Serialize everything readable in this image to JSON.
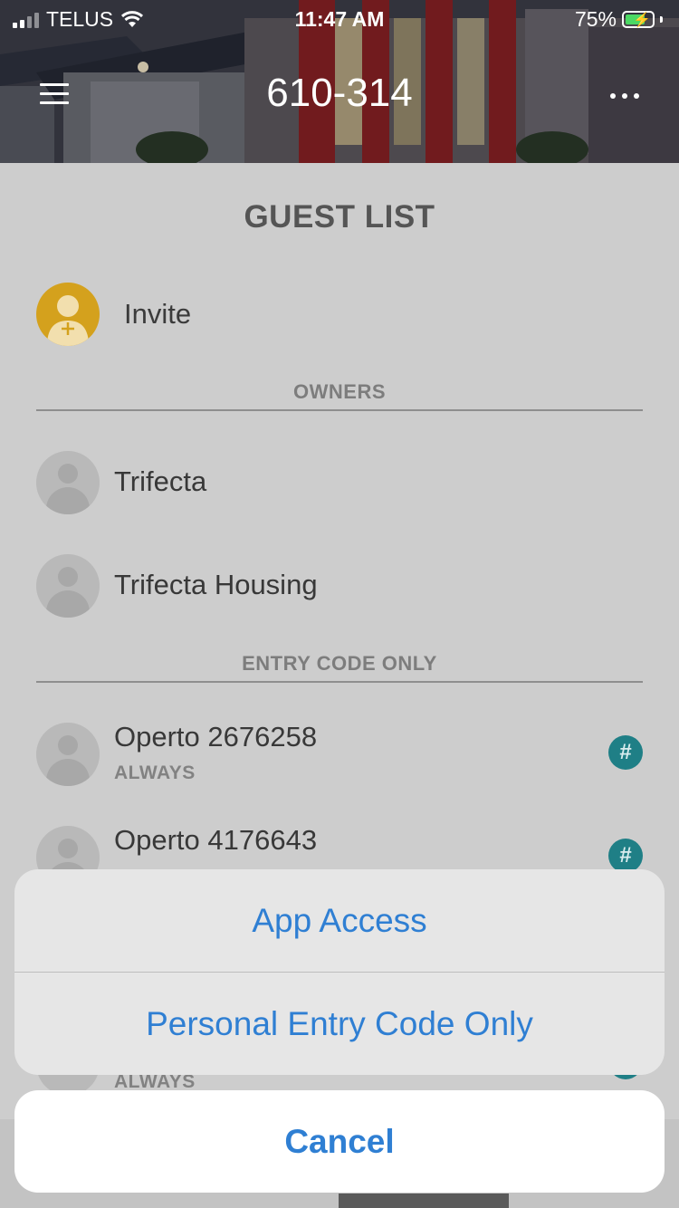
{
  "status_bar": {
    "carrier": "TELUS",
    "time": "11:47 AM",
    "battery": "75%",
    "battery_level": 0.75
  },
  "header": {
    "title": "610-314",
    "menu_icon": "hamburger-menu-icon",
    "more_icon": "more-dots-icon"
  },
  "page": {
    "title": "GUEST LIST",
    "invite_label": "Invite"
  },
  "sections": {
    "owners": "OWNERS",
    "entry_code_only": "ENTRY CODE ONLY"
  },
  "owners": [
    {
      "name": "Trifecta"
    },
    {
      "name": "Trifecta Housing"
    }
  ],
  "entry_code_guests": [
    {
      "name": "Operto 2676258",
      "schedule": "ALWAYS"
    },
    {
      "name": "Operto 4176643"
    }
  ],
  "peek_row": {
    "schedule": "ALWAYS"
  },
  "action_sheet": {
    "option_1": "App Access",
    "option_2": "Personal Entry Code Only",
    "cancel": "Cancel"
  },
  "colors": {
    "accent": "#2f7fd3",
    "invite_avatar": "#d4a11d",
    "entry_code_badge": "#1f7f86"
  }
}
